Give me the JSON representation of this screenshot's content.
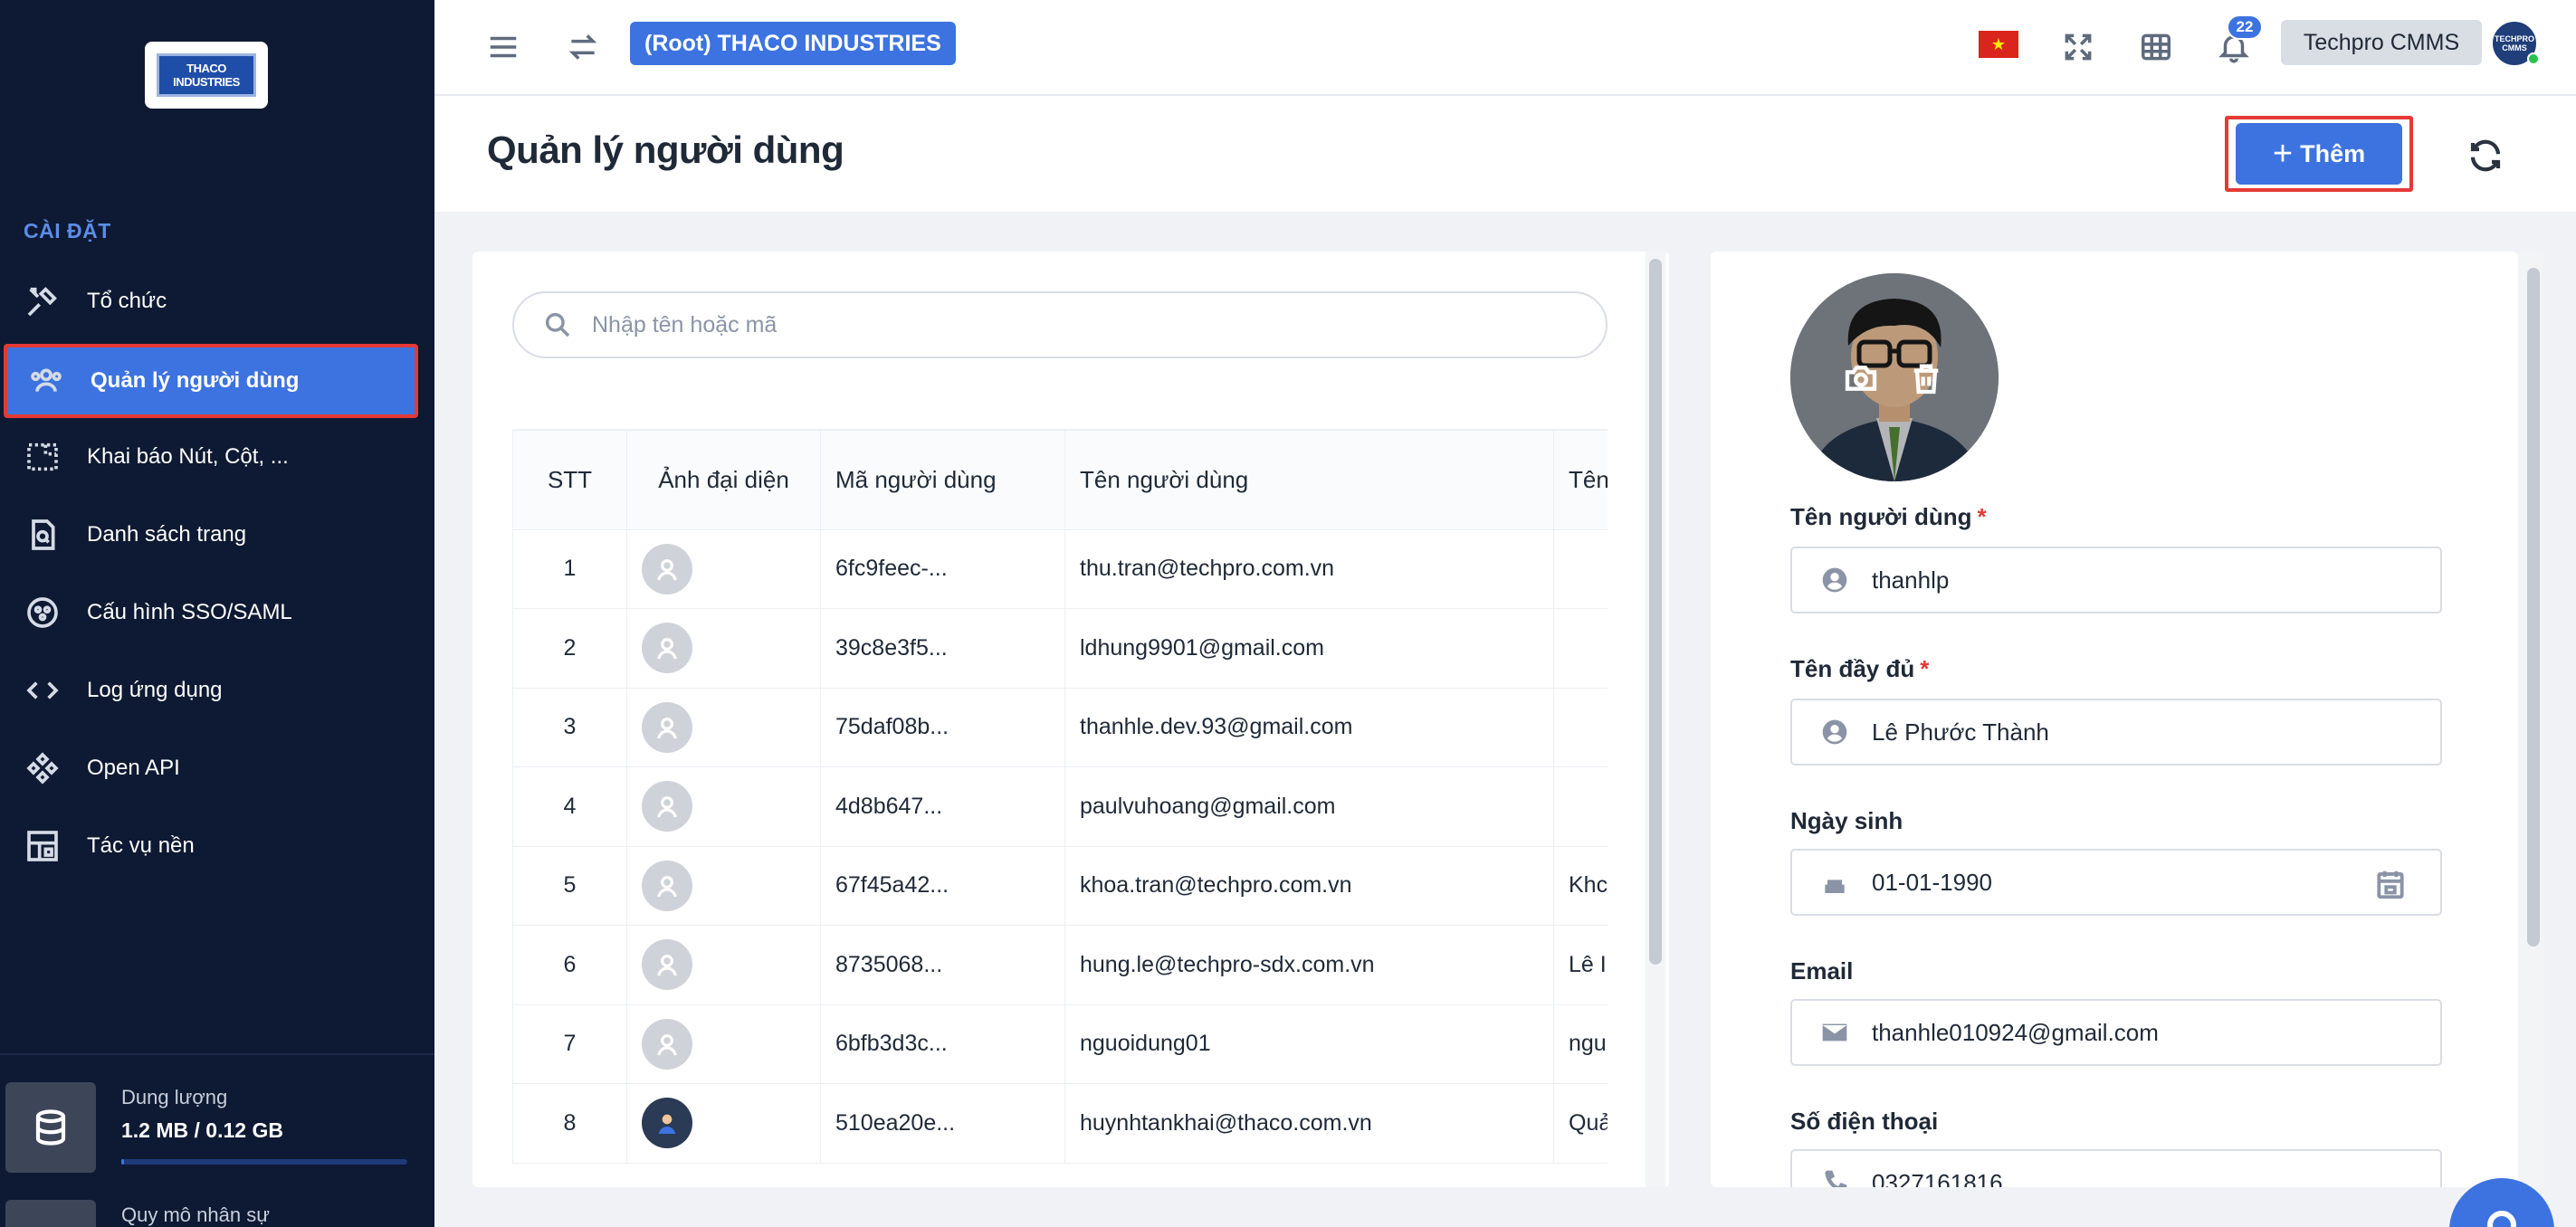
{
  "sidebar": {
    "logo_text": "THACO INDUSTRIES",
    "section_title": "CÀI ĐẶT",
    "items": [
      {
        "label": "Tổ chức",
        "icon": "tools-icon"
      },
      {
        "label": "Quản lý người dùng",
        "icon": "users-icon"
      },
      {
        "label": "Khai báo Nút, Cột, ...",
        "icon": "layout-dashed-icon"
      },
      {
        "label": "Danh sách trang",
        "icon": "page-search-icon"
      },
      {
        "label": "Cấu hình SSO/SAML",
        "icon": "sso-icon"
      },
      {
        "label": "Log ứng dụng",
        "icon": "code-icon"
      },
      {
        "label": "Open API",
        "icon": "api-icon"
      },
      {
        "label": "Tác vụ nền",
        "icon": "background-task-icon"
      }
    ],
    "storage": {
      "label": "Dung lượng",
      "value": "1.2 MB / 0.12 GB",
      "fill_fraction": 0.01
    },
    "staff": {
      "label": "Quy mô nhân sự"
    }
  },
  "topbar": {
    "org": "(Root) THACO INDUSTRIES",
    "notifications": "22",
    "app_name": "Techpro CMMS",
    "avatar_text": "TECHPRO CMMS"
  },
  "page": {
    "title": "Quản lý người dùng",
    "add_label": "Thêm"
  },
  "search": {
    "placeholder": "Nhập tên hoặc mã"
  },
  "table": {
    "headers": {
      "stt": "STT",
      "avatar": "Ảnh đại diện",
      "code": "Mã người dùng",
      "username": "Tên người dùng",
      "fullname": "Tên"
    },
    "rows": [
      {
        "stt": "1",
        "code": "6fc9feec-...",
        "username": "thu.tran@techpro.com.vn",
        "fullname": "",
        "photo": false
      },
      {
        "stt": "2",
        "code": "39c8e3f5...",
        "username": "ldhung9901@gmail.com",
        "fullname": "",
        "photo": false
      },
      {
        "stt": "3",
        "code": "75daf08b...",
        "username": "thanhle.dev.93@gmail.com",
        "fullname": "",
        "photo": false
      },
      {
        "stt": "4",
        "code": "4d8b647...",
        "username": "paulvuhoang@gmail.com",
        "fullname": "",
        "photo": false
      },
      {
        "stt": "5",
        "code": "67f45a42...",
        "username": "khoa.tran@techpro.com.vn",
        "fullname": "Khc",
        "photo": false
      },
      {
        "stt": "6",
        "code": "8735068...",
        "username": "hung.le@techpro-sdx.com.vn",
        "fullname": "Lê I",
        "photo": false
      },
      {
        "stt": "7",
        "code": "6bfb3d3c...",
        "username": "nguoidung01",
        "fullname": "ngu",
        "photo": false
      },
      {
        "stt": "8",
        "code": "510ea20e...",
        "username": "huynhtankhai@thaco.com.vn",
        "fullname": "Quả",
        "photo": true
      }
    ]
  },
  "detail": {
    "username_label": "Tên người dùng",
    "username_value": "thanhlp",
    "fullname_label": "Tên đầy đủ",
    "fullname_value": "Lê Phước Thành",
    "dob_label": "Ngày sinh",
    "dob_value": "01-01-1990",
    "email_label": "Email",
    "email_value": "thanhle010924@gmail.com",
    "phone_label": "Số điện thoại",
    "phone_value": "0327161816",
    "required_mark": "*"
  },
  "colors": {
    "primary": "#3d73e0",
    "sidebar_bg": "#0e1a33",
    "highlight": "#e53935"
  }
}
